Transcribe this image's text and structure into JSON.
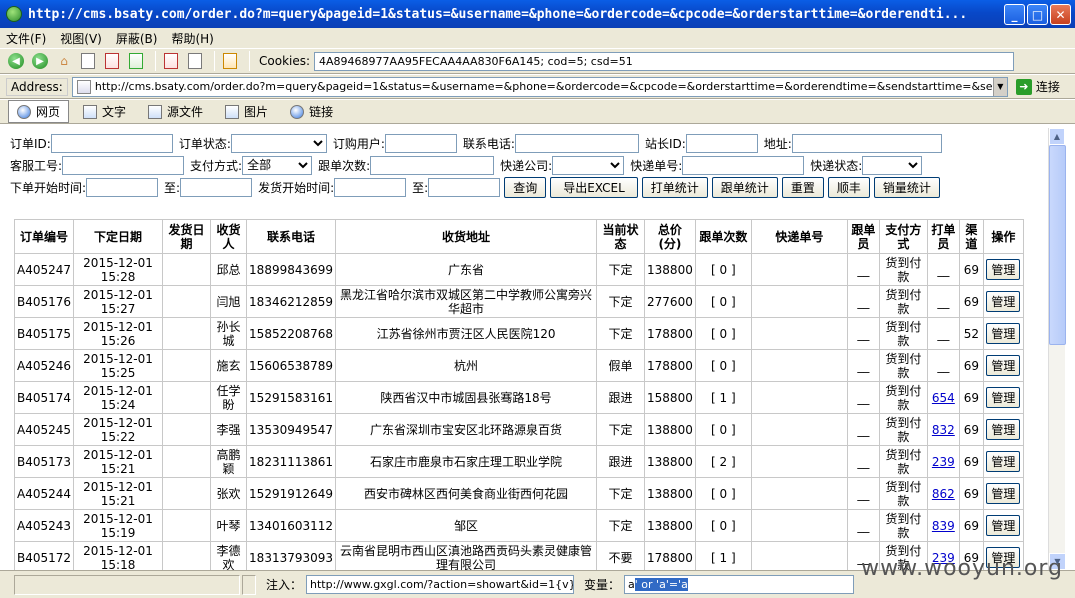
{
  "window": {
    "title": "http://cms.bsaty.com/order.do?m=query&pageid=1&status=&username=&phone=&ordercode=&cpcode=&orderstarttime=&orderendti...",
    "minimize": "_",
    "maximize": "□",
    "close": "✕"
  },
  "menu": [
    "文件(F)",
    "视图(V)",
    "屏蔽(B)",
    "帮助(H)"
  ],
  "toolbar": {
    "cookies_label": "Cookies:",
    "cookies_value": "4A89468977AA95FECAA4AA830F6A145; cod=5; csd=51"
  },
  "address": {
    "label": "Address:",
    "url": "http://cms.bsaty.com/order.do?m=query&pageid=1&status=&username=&phone=&ordercode=&cpcode=&orderstarttime=&orderendtime=&sendstarttime=&sendendtime=&checknum=&kuaidinam",
    "go_label": "连接"
  },
  "tabs": [
    "网页",
    "文字",
    "源文件",
    "图片",
    "链接"
  ],
  "filters": {
    "order_id": "订单ID:",
    "order_status": "订单状态:",
    "order_user": "订购用户:",
    "phone": "联系电话:",
    "station_id": "站长ID:",
    "address": "地址:",
    "service_no": "客服工号:",
    "pay_method": "支付方式:",
    "pay_method_value": "全部",
    "follow_count": "跟单次数:",
    "courier_company": "快递公司:",
    "courier_no": "快递单号:",
    "courier_status": "快递状态:",
    "order_start": "下单开始时间:",
    "to1": "至:",
    "ship_start": "发货开始时间:",
    "to2": "至:"
  },
  "buttons": [
    "查询",
    "导出EXCEL",
    "打单统计",
    "跟单统计",
    "重置",
    "顺丰",
    "销量统计"
  ],
  "table": {
    "headers": [
      "订单编号",
      "下定日期",
      "发货日期",
      "收货人",
      "联系电话",
      "收货地址",
      "当前状态",
      "总价(分)",
      "跟单次数",
      "快递单号",
      "跟单员",
      "支付方式",
      "打单员",
      "渠道",
      "操作"
    ],
    "manage_label": "管理",
    "rows": [
      {
        "id": "A405247",
        "date": "2015-12-01 15:28",
        "ship": "",
        "name": "邱总",
        "phone": "18899843699",
        "addr": "广东省",
        "status": "下定",
        "price": "138800",
        "follow": "[ 0 ]",
        "courier": "",
        "follower": "__",
        "pay": "货到付款",
        "printer": "__",
        "printer_link": false,
        "channel": "69"
      },
      {
        "id": "B405176",
        "date": "2015-12-01 15:27",
        "ship": "",
        "name": "闫旭",
        "phone": "18346212859",
        "addr": "黑龙江省哈尔滨市双城区第二中学教师公寓旁兴华超市",
        "status": "下定",
        "price": "277600",
        "follow": "[ 0 ]",
        "courier": "",
        "follower": "__",
        "pay": "货到付款",
        "printer": "__",
        "printer_link": false,
        "channel": "69"
      },
      {
        "id": "B405175",
        "date": "2015-12-01 15:26",
        "ship": "",
        "name": "孙长城",
        "phone": "15852208768",
        "addr": "江苏省徐州市贾汪区人民医院120",
        "status": "下定",
        "price": "178800",
        "follow": "[ 0 ]",
        "courier": "",
        "follower": "__",
        "pay": "货到付款",
        "printer": "__",
        "printer_link": false,
        "channel": "52"
      },
      {
        "id": "A405246",
        "date": "2015-12-01 15:25",
        "ship": "",
        "name": "施玄",
        "phone": "15606538789",
        "addr": "杭州",
        "status": "假单",
        "price": "178800",
        "follow": "[ 0 ]",
        "courier": "",
        "follower": "__",
        "pay": "货到付款",
        "printer": "__",
        "printer_link": false,
        "channel": "69"
      },
      {
        "id": "B405174",
        "date": "2015-12-01 15:24",
        "ship": "",
        "name": "任学盼",
        "phone": "15291583161",
        "addr": "陕西省汉中市城固县张骞路18号",
        "status": "跟进",
        "price": "158800",
        "follow": "[ 1 ]",
        "courier": "",
        "follower": "__",
        "pay": "货到付款",
        "printer": "654",
        "printer_link": true,
        "channel": "69"
      },
      {
        "id": "A405245",
        "date": "2015-12-01 15:22",
        "ship": "",
        "name": "李强",
        "phone": "13530949547",
        "addr": "广东省深圳市宝安区北环路源泉百货",
        "status": "下定",
        "price": "138800",
        "follow": "[ 0 ]",
        "courier": "",
        "follower": "__",
        "pay": "货到付款",
        "printer": "832",
        "printer_link": true,
        "channel": "69"
      },
      {
        "id": "B405173",
        "date": "2015-12-01 15:21",
        "ship": "",
        "name": "高鹏颖",
        "phone": "18231113861",
        "addr": "石家庄市鹿泉市石家庄理工职业学院",
        "status": "跟进",
        "price": "138800",
        "follow": "[ 2 ]",
        "courier": "",
        "follower": "__",
        "pay": "货到付款",
        "printer": "239",
        "printer_link": true,
        "channel": "69"
      },
      {
        "id": "A405244",
        "date": "2015-12-01 15:21",
        "ship": "",
        "name": "张欢",
        "phone": "15291912649",
        "addr": "西安市碑林区西何美食商业街西何花园",
        "status": "下定",
        "price": "138800",
        "follow": "[ 0 ]",
        "courier": "",
        "follower": "__",
        "pay": "货到付款",
        "printer": "862",
        "printer_link": true,
        "channel": "69"
      },
      {
        "id": "A405243",
        "date": "2015-12-01 15:19",
        "ship": "",
        "name": "叶琴",
        "phone": "13401603112",
        "addr": "邹区",
        "status": "下定",
        "price": "138800",
        "follow": "[ 0 ]",
        "courier": "",
        "follower": "__",
        "pay": "货到付款",
        "printer": "839",
        "printer_link": true,
        "channel": "69"
      },
      {
        "id": "B405172",
        "date": "2015-12-01 15:18",
        "ship": "",
        "name": "李德欢",
        "phone": "18313793093",
        "addr": "云南省昆明市西山区滇池路西贡码头素灵健康管理有限公司",
        "status": "不要",
        "price": "178800",
        "follow": "[ 1 ]",
        "courier": "",
        "follower": "__",
        "pay": "货到付款",
        "printer": "239",
        "printer_link": true,
        "channel": "69"
      }
    ]
  },
  "status": {
    "inject_label": "注入：",
    "inject_value": "http://www.gxgl.com/?action=showart&id=1{v}",
    "var_label": "变量：",
    "var_prefix": "a",
    "var_highlight": "' or 'a'='a"
  },
  "watermark": "www.wooyun.org"
}
